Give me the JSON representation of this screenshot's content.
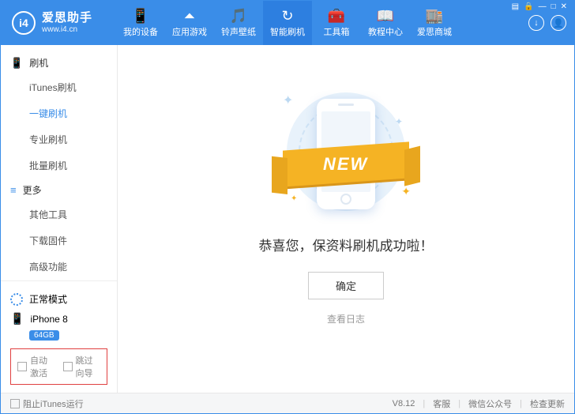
{
  "brand": {
    "name": "爱思助手",
    "site": "www.i4.cn",
    "logo_text": "i4"
  },
  "win": {
    "menu": "▤",
    "lock": "🔒",
    "min": "—",
    "max": "□",
    "close": "✕"
  },
  "nav": [
    {
      "icon": "📱",
      "label": "我的设备"
    },
    {
      "icon": "⏶",
      "label": "应用游戏"
    },
    {
      "icon": "🎵",
      "label": "铃声壁纸"
    },
    {
      "icon": "↻",
      "label": "智能刷机",
      "active": true
    },
    {
      "icon": "🧰",
      "label": "工具箱"
    },
    {
      "icon": "📖",
      "label": "教程中心"
    },
    {
      "icon": "🏬",
      "label": "爱思商城"
    }
  ],
  "header_icons": {
    "download": "↓",
    "user": "👤"
  },
  "sidebar": {
    "groups": [
      {
        "icon": "📱",
        "title": "刷机",
        "items": [
          "iTunes刷机",
          "一键刷机",
          "专业刷机",
          "批量刷机"
        ],
        "active_index": 1
      },
      {
        "icon": "≡",
        "title": "更多",
        "items": [
          "其他工具",
          "下载固件",
          "高级功能"
        ]
      }
    ],
    "mode": "正常模式",
    "device": {
      "name": "iPhone 8",
      "storage": "64GB"
    },
    "checks": {
      "auto_activate": "自动激活",
      "skip_guide": "跳过向导"
    }
  },
  "main": {
    "ribbon": "NEW",
    "success": "恭喜您，保资料刷机成功啦！",
    "ok": "确定",
    "view_log": "查看日志"
  },
  "footer": {
    "block_itunes": "阻止iTunes运行",
    "version": "V8.12",
    "support": "客服",
    "wechat": "微信公众号",
    "check_update": "检查更新"
  }
}
